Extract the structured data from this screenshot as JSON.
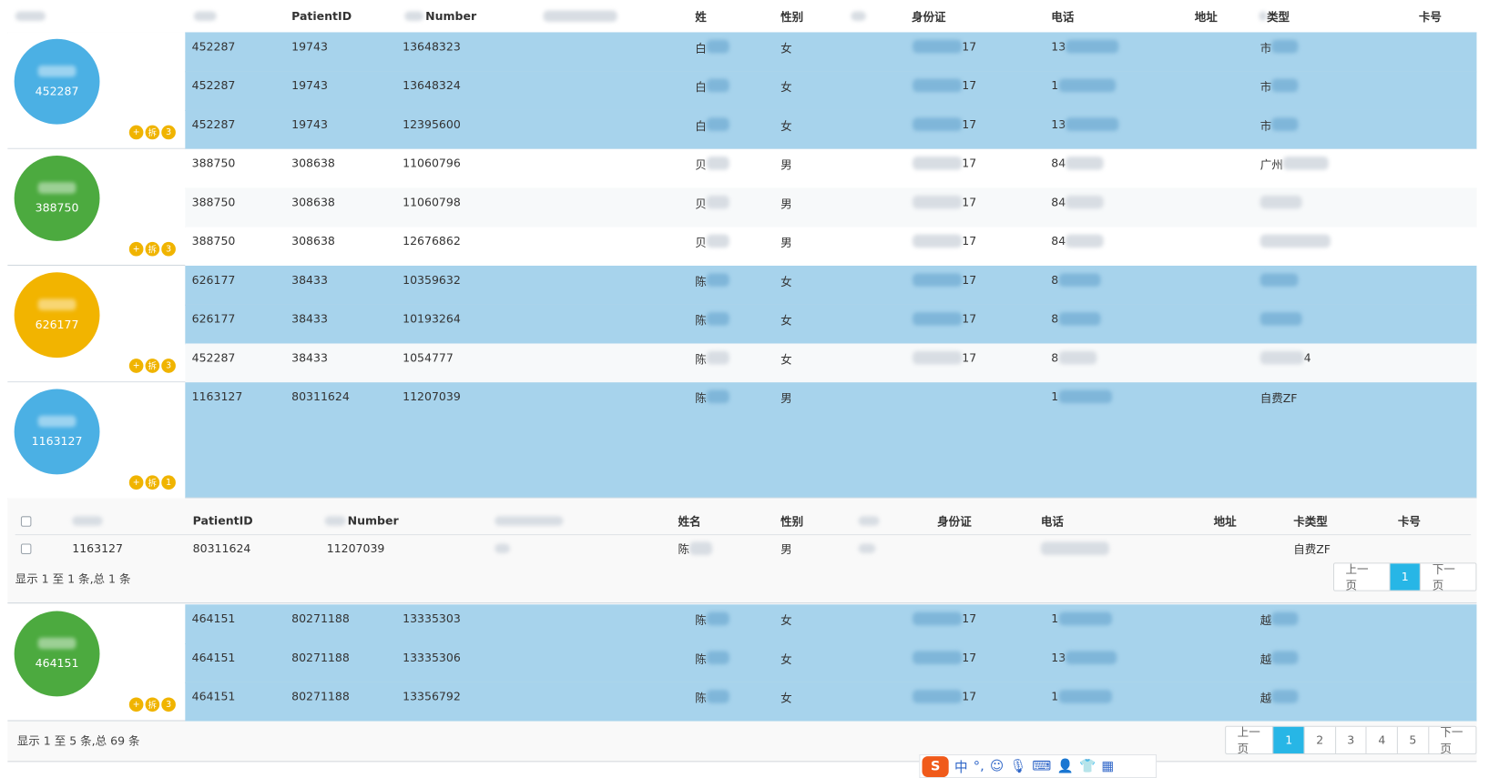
{
  "headers": {
    "patient_id": "PatientID",
    "number": "Number",
    "name": "姓",
    "gender": "性别",
    "id_card": "身份证",
    "phone": "电话",
    "address": "地址",
    "type": "类型",
    "card_no": "卡号"
  },
  "groups": [
    {
      "id": "452287",
      "color": "#4bb0e4",
      "count": "3",
      "rows": [
        {
          "c1": "452287",
          "c2": "19743",
          "c3": "13648323",
          "name": "白",
          "gender": "女",
          "id": "17",
          "phone": "13",
          "type": "市"
        },
        {
          "c1": "452287",
          "c2": "19743",
          "c3": "13648324",
          "name": "白",
          "gender": "女",
          "id": "17",
          "phone": "1",
          "type": "市"
        },
        {
          "c1": "452287",
          "c2": "19743",
          "c3": "12395600",
          "name": "白",
          "gender": "女",
          "id": "17",
          "phone": "13",
          "type": "市"
        }
      ]
    },
    {
      "id": "388750",
      "color": "#4caa3f",
      "count": "3",
      "rows": [
        {
          "c1": "388750",
          "c2": "308638",
          "c3": "11060796",
          "name": "贝",
          "gender": "男",
          "id": "17",
          "phone": "84",
          "type": "广州"
        },
        {
          "c1": "388750",
          "c2": "308638",
          "c3": "11060798",
          "name": "贝",
          "gender": "男",
          "id": "17",
          "phone": "84",
          "type": ""
        },
        {
          "c1": "388750",
          "c2": "308638",
          "c3": "12676862",
          "name": "贝",
          "gender": "男",
          "id": "17",
          "phone": "84",
          "type": ""
        }
      ]
    },
    {
      "id": "626177",
      "color": "#f2b400",
      "count": "3",
      "rows": [
        {
          "c1": "626177",
          "c2": "38433",
          "c3": "10359632",
          "name": "陈",
          "gender": "女",
          "id": "17",
          "phone": "8",
          "type": ""
        },
        {
          "c1": "626177",
          "c2": "38433",
          "c3": "10193264",
          "name": "陈",
          "gender": "女",
          "id": "17",
          "phone": "8",
          "type": ""
        },
        {
          "c1": "452287",
          "c2": "38433",
          "c3": "1054777",
          "name": "陈",
          "gender": "女",
          "id": "17",
          "phone": "8",
          "type": "4"
        }
      ]
    },
    {
      "id": "1163127",
      "color": "#4bb0e4",
      "count": "1",
      "rows": [
        {
          "c1": "1163127",
          "c2": "80311624",
          "c3": "11207039",
          "name": "陈",
          "gender": "男",
          "id": "",
          "phone": "1",
          "type": "自费ZF"
        }
      ]
    },
    {
      "id": "464151",
      "color": "#4caa3f",
      "count": "3",
      "rows": [
        {
          "c1": "464151",
          "c2": "80271188",
          "c3": "13335303",
          "name": "陈",
          "gender": "女",
          "id": "17",
          "phone": "1",
          "type": "越"
        },
        {
          "c1": "464151",
          "c2": "80271188",
          "c3": "13335306",
          "name": "陈",
          "gender": "女",
          "id": "17",
          "phone": "13",
          "type": "越"
        },
        {
          "c1": "464151",
          "c2": "80271188",
          "c3": "13356792",
          "name": "陈",
          "gender": "女",
          "id": "17",
          "phone": "1",
          "type": "越"
        }
      ]
    }
  ],
  "badge_plus": "+",
  "badge_split": "拆",
  "subtable": {
    "headers": {
      "patient_id": "PatientID",
      "number": "Number",
      "name": "姓名",
      "gender": "性别",
      "id_card": "身份证",
      "phone": "电话",
      "address": "地址",
      "card_type": "卡类型",
      "card_no": "卡号"
    },
    "row": {
      "c1": "1163127",
      "c2": "80311624",
      "c3": "11207039",
      "name": "陈",
      "gender": "男",
      "type": "自费ZF"
    },
    "info": "显示 1 至 1 条,总 1 条",
    "prev": "上一页",
    "page": "1",
    "next": "下一页"
  },
  "footer": {
    "info": "显示 1 至 5 条,总 69 条",
    "prev": "上一页",
    "pages": [
      "1",
      "2",
      "3",
      "4",
      "5"
    ],
    "next": "下一页"
  },
  "ime": {
    "logo": "S",
    "lang": "中",
    "punct": "°,"
  }
}
